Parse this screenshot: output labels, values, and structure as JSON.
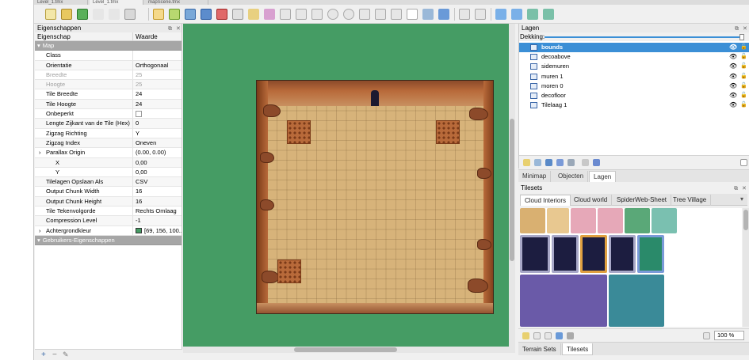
{
  "doc_tabs": [
    "Level_1.tmx",
    "Level_1.tmx",
    "mapScene.tmx"
  ],
  "properties_panel": {
    "title": "Eigenschappen",
    "col_property": "Eigenschap",
    "col_value": "Waarde",
    "group_map": "Map",
    "rows": [
      {
        "key": "Class",
        "value": ""
      },
      {
        "key": "Orientatie",
        "value": "Orthogonaal"
      },
      {
        "key": "Breedte",
        "value": "25"
      },
      {
        "key": "Hoogte",
        "value": "25"
      },
      {
        "key": "Tile Breedte",
        "value": "24"
      },
      {
        "key": "Tile Hoogte",
        "value": "24"
      },
      {
        "key": "Onbeperkt",
        "value": ""
      },
      {
        "key": "Lengte Zijkant van de Tile (Hex)",
        "value": "0"
      },
      {
        "key": "Zigzag Richting",
        "value": "Y"
      },
      {
        "key": "Zigzag Index",
        "value": "Oneven"
      },
      {
        "key": "Parallax Origin",
        "value": "(0.00, 0.00)"
      },
      {
        "key": "X",
        "value": "0,00"
      },
      {
        "key": "Y",
        "value": "0,00"
      },
      {
        "key": "Tilelagen Opslaan Als",
        "value": "CSV"
      },
      {
        "key": "Output Chunk Width",
        "value": "16"
      },
      {
        "key": "Output Chunk Height",
        "value": "16"
      },
      {
        "key": "Tile Tekenvolgorde",
        "value": "Rechts Omlaag"
      },
      {
        "key": "Compression Level",
        "value": "-1"
      },
      {
        "key": "Achtergrondkleur",
        "value": "[69, 156, 100..."
      }
    ],
    "group_custom": "Gebruikers-Eigenschappen"
  },
  "layers_panel": {
    "title": "Lagen",
    "opacity_label": "Dekking:",
    "opacity": 1.0,
    "layers": [
      {
        "name": "bounds",
        "selected": true
      },
      {
        "name": "decoabove",
        "selected": false
      },
      {
        "name": "sidemuren",
        "selected": false
      },
      {
        "name": "muren 1",
        "selected": false
      },
      {
        "name": "moren 0",
        "selected": false
      },
      {
        "name": "decofloor",
        "selected": false
      },
      {
        "name": "Tilelaag 1",
        "selected": false
      }
    ]
  },
  "mid_tabs": {
    "minimap": "Minimap",
    "objects": "Objecten",
    "layers": "Lagen"
  },
  "tilesets_panel": {
    "title": "Tilesets",
    "tabs": [
      "Cloud Interiors",
      "Cloud world",
      "SpiderWeb-Sheet",
      "Tree Village"
    ],
    "zoom": "100 %"
  },
  "bottom_tabs": {
    "terrain": "Terrain Sets",
    "tilesets": "Tilesets"
  },
  "colors": {
    "canvas_bg": "#459c64",
    "selection": "#3b8fd6"
  }
}
